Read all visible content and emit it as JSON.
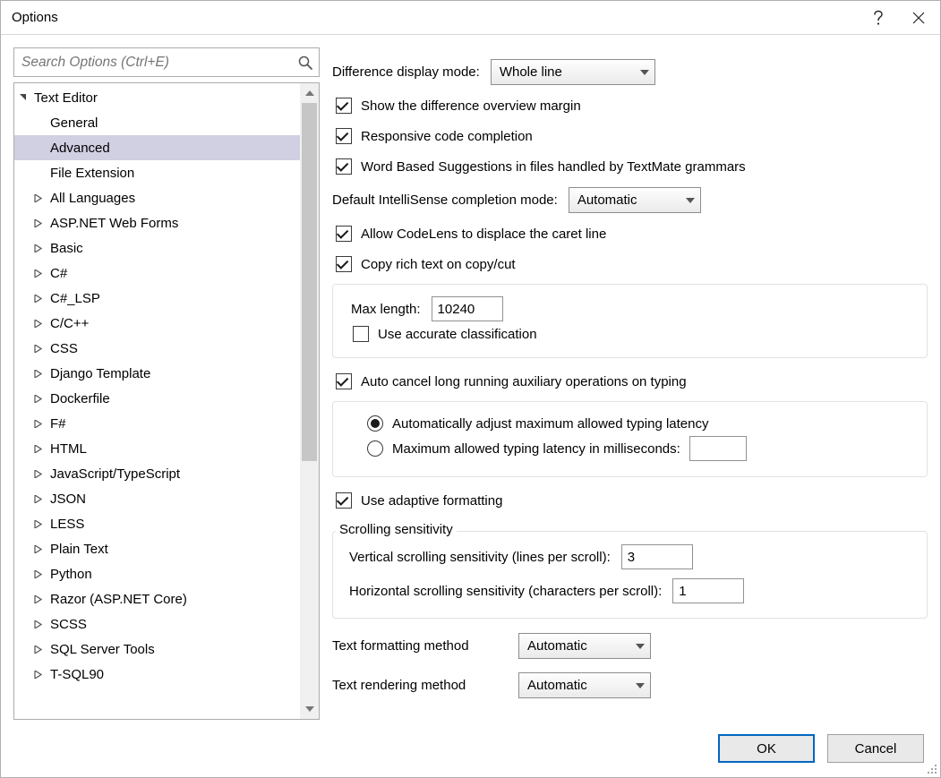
{
  "window": {
    "title": "Options"
  },
  "search": {
    "placeholder": "Search Options (Ctrl+E)"
  },
  "tree": {
    "root": "Text Editor",
    "leaves": [
      "General",
      "Advanced",
      "File Extension"
    ],
    "nodes": [
      "All Languages",
      "ASP.NET Web Forms",
      "Basic",
      "C#",
      "C#_LSP",
      "C/C++",
      "CSS",
      "Django Template",
      "Dockerfile",
      "F#",
      "HTML",
      "JavaScript/TypeScript",
      "JSON",
      "LESS",
      "Plain Text",
      "Python",
      "Razor (ASP.NET Core)",
      "SCSS",
      "SQL Server Tools",
      "T-SQL90"
    ],
    "selected": "Advanced"
  },
  "panel": {
    "diff_mode": {
      "label": "Difference display mode:",
      "value": "Whole line"
    },
    "show_overview": "Show the difference overview margin",
    "responsive": "Responsive code completion",
    "wordbased": "Word Based Suggestions in files handled by TextMate grammars",
    "intellisense": {
      "label": "Default IntelliSense completion mode:",
      "value": "Automatic"
    },
    "codelens": "Allow CodeLens to displace the caret line",
    "copyrich": "Copy rich text on copy/cut",
    "maxlen": {
      "label": "Max length:",
      "value": "10240"
    },
    "accurate": "Use accurate classification",
    "autocancel": "Auto cancel long running auxiliary operations on typing",
    "radio_auto": "Automatically adjust maximum allowed typing latency",
    "radio_max": "Maximum allowed typing latency in milliseconds:",
    "radio_max_value": "",
    "adaptive": "Use adaptive formatting",
    "scroll_title": "Scrolling sensitivity",
    "vscroll": {
      "label": "Vertical scrolling sensitivity (lines per scroll):",
      "value": "3"
    },
    "hscroll": {
      "label": "Horizontal scrolling sensitivity (characters per scroll):",
      "value": "1"
    },
    "fmt_method": {
      "label": "Text formatting method",
      "value": "Automatic"
    },
    "render_method": {
      "label": "Text rendering method",
      "value": "Automatic"
    }
  },
  "buttons": {
    "ok": "OK",
    "cancel": "Cancel"
  }
}
